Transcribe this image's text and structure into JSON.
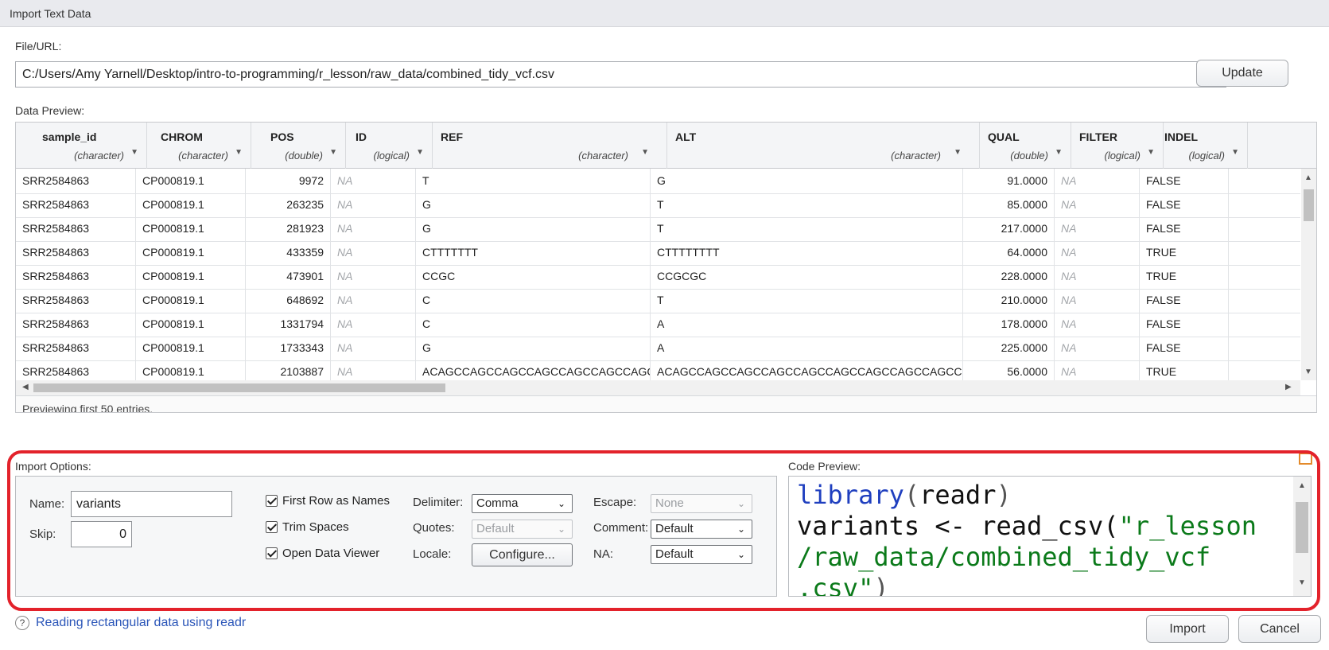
{
  "window": {
    "title": "Import Text Data"
  },
  "file": {
    "label": "File/URL:",
    "path": "C:/Users/Amy Yarnell/Desktop/intro-to-programming/r_lesson/raw_data/combined_tidy_vcf.csv",
    "update_label": "Update"
  },
  "preview": {
    "label": "Data Preview:",
    "footer": "Previewing first 50 entries.",
    "columns": [
      {
        "name": "sample_id",
        "type": "(character)"
      },
      {
        "name": "CHROM",
        "type": "(character)"
      },
      {
        "name": "POS",
        "type": "(double)"
      },
      {
        "name": "ID",
        "type": "(logical)"
      },
      {
        "name": "REF",
        "type": "(character)"
      },
      {
        "name": "ALT",
        "type": "(character)"
      },
      {
        "name": "QUAL",
        "type": "(double)"
      },
      {
        "name": "FILTER",
        "type": "(logical)"
      },
      {
        "name": "INDEL",
        "type": "(logical)"
      }
    ],
    "rows": [
      [
        "SRR2584863",
        "CP000819.1",
        "9972",
        "NA",
        "T",
        "G",
        "91.0000",
        "NA",
        "FALSE"
      ],
      [
        "SRR2584863",
        "CP000819.1",
        "263235",
        "NA",
        "G",
        "T",
        "85.0000",
        "NA",
        "FALSE"
      ],
      [
        "SRR2584863",
        "CP000819.1",
        "281923",
        "NA",
        "G",
        "T",
        "217.0000",
        "NA",
        "FALSE"
      ],
      [
        "SRR2584863",
        "CP000819.1",
        "433359",
        "NA",
        "CTTTTTTT",
        "CTTTTTTTT",
        "64.0000",
        "NA",
        "TRUE"
      ],
      [
        "SRR2584863",
        "CP000819.1",
        "473901",
        "NA",
        "CCGC",
        "CCGCGC",
        "228.0000",
        "NA",
        "TRUE"
      ],
      [
        "SRR2584863",
        "CP000819.1",
        "648692",
        "NA",
        "C",
        "T",
        "210.0000",
        "NA",
        "FALSE"
      ],
      [
        "SRR2584863",
        "CP000819.1",
        "1331794",
        "NA",
        "C",
        "A",
        "178.0000",
        "NA",
        "FALSE"
      ],
      [
        "SRR2584863",
        "CP000819.1",
        "1733343",
        "NA",
        "G",
        "A",
        "225.0000",
        "NA",
        "FALSE"
      ],
      [
        "SRR2584863",
        "CP000819.1",
        "2103887",
        "NA",
        "ACAGCCAGCCAGCCAGCCAGCCAGCCAGCCAG",
        "ACAGCCAGCCAGCCAGCCAGCCAGCCAGCCAGCCAGCC...",
        "56.0000",
        "NA",
        "TRUE"
      ]
    ]
  },
  "options": {
    "label": "Import Options:",
    "name_label": "Name:",
    "name_value": "variants",
    "skip_label": "Skip:",
    "skip_value": "0",
    "first_row": "First Row as Names",
    "trim_spaces": "Trim Spaces",
    "open_viewer": "Open Data Viewer",
    "delimiter_label": "Delimiter:",
    "delimiter_value": "Comma",
    "quotes_label": "Quotes:",
    "quotes_value": "Default",
    "locale_label": "Locale:",
    "configure_label": "Configure...",
    "escape_label": "Escape:",
    "escape_value": "None",
    "comment_label": "Comment:",
    "comment_value": "Default",
    "na_label": "NA:",
    "na_value": "Default"
  },
  "code_preview": {
    "label": "Code Preview:",
    "line1_kw": "library",
    "line1_rest": "readr",
    "line2_pre": "variants <- read_csv(",
    "line2_str": "\"r_lesson",
    "line3_str": "/raw_data/combined_tidy_vcf",
    "line4_str": ".csv\""
  },
  "help": {
    "link_text": "Reading rectangular data using readr"
  },
  "actions": {
    "import_label": "Import",
    "cancel_label": "Cancel"
  },
  "colors": {
    "highlight": "#e3222b",
    "link": "#2a55b8",
    "string": "#0b7a1a",
    "keyword": "#1f3fbf"
  }
}
